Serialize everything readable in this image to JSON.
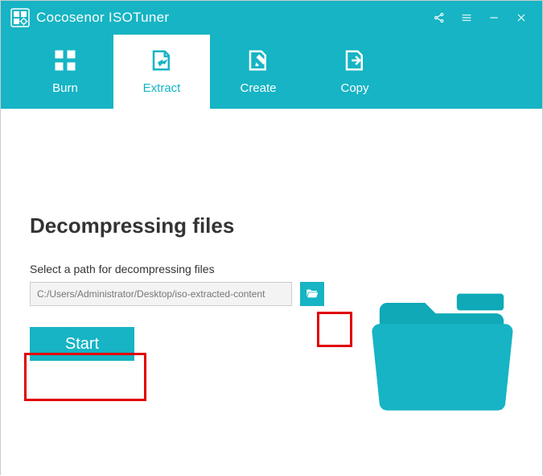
{
  "app": {
    "title": "Cocosenor ISOTuner"
  },
  "tabs": {
    "burn": "Burn",
    "extract": "Extract",
    "create": "Create",
    "copy": "Copy"
  },
  "main": {
    "heading": "Decompressing files",
    "instruction": "Select a path for decompressing files",
    "path_value": "C:/Users/Administrator/Desktop/iso-extracted-content",
    "start_label": "Start"
  },
  "colors": {
    "accent": "#16b4c4",
    "highlight": "#e10000"
  }
}
